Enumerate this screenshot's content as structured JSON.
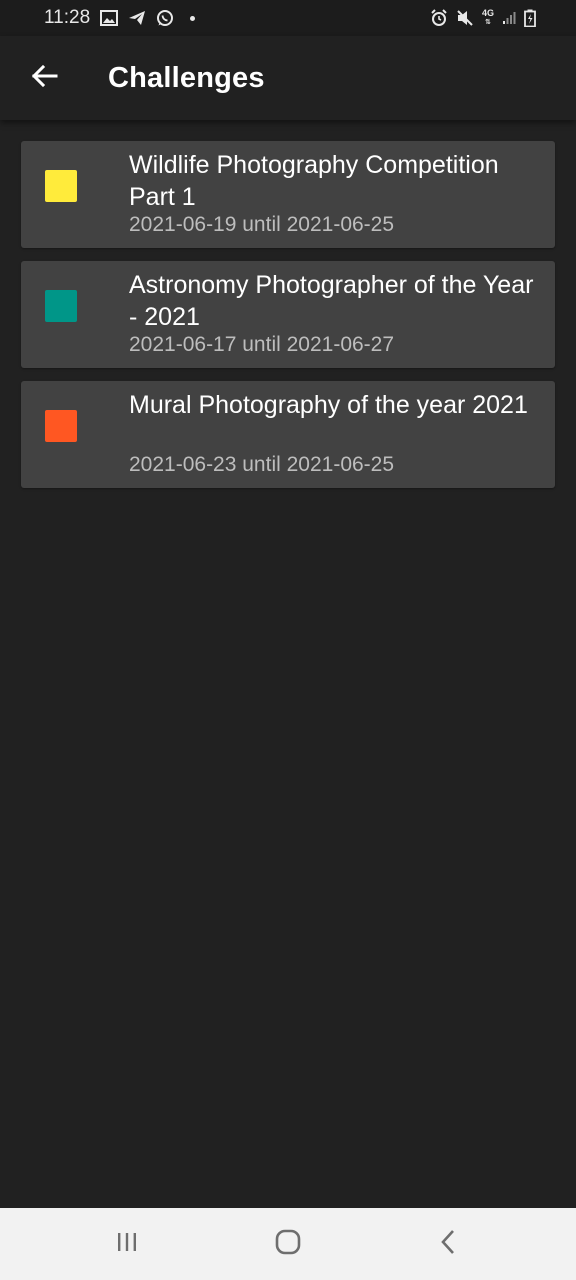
{
  "status_bar": {
    "time": "11:28",
    "left_icons": [
      "gallery-icon",
      "telegram-icon",
      "whatsapp-icon",
      "notification-dot"
    ],
    "right_icons": [
      "alarm-icon",
      "mute-icon",
      "4g-icon",
      "signal-icon",
      "battery-icon"
    ],
    "network_label": "4G"
  },
  "app_bar": {
    "title": "Challenges",
    "back_icon": "arrow-left-icon"
  },
  "challenges": [
    {
      "title": "Wildlife Photography Competition Part 1",
      "dates": "2021-06-19 until 2021-06-25",
      "color": "#FFEB3B"
    },
    {
      "title": "Astronomy Photographer of the Year - 2021",
      "dates": "2021-06-17 until 2021-06-27",
      "color": "#009688"
    },
    {
      "title": "Mural Photography of the year 2021",
      "dates": "2021-06-23 until 2021-06-25",
      "color": "#FF5722"
    }
  ],
  "nav_bar": {
    "recents_icon": "recents-icon",
    "home_icon": "home-icon",
    "back_icon": "back-chevron-icon"
  },
  "colors": {
    "background": "#212121",
    "card": "#424242",
    "status_bar": "#1c1c1c",
    "nav_bar": "#f2f2f2",
    "subtitle": "#bdbdbd"
  }
}
